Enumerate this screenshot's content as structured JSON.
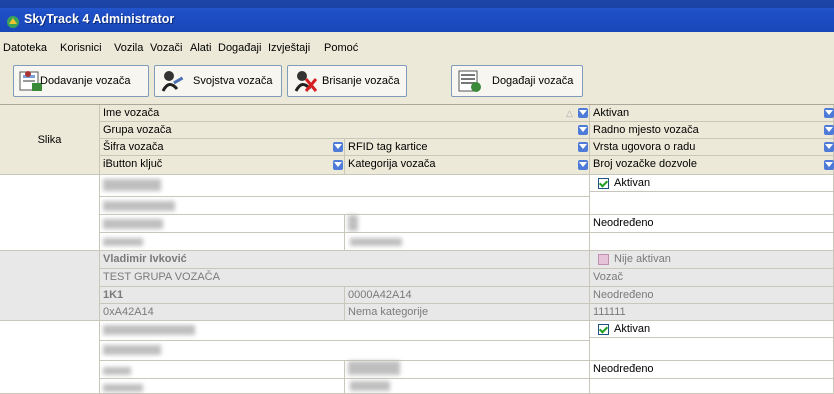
{
  "window": {
    "title": "SkyTrack 4 Administrator"
  },
  "menu": [
    "Datoteka",
    "Korisnici",
    "Vozila",
    "Vozači",
    "Alati",
    "Događaji",
    "Izvještaji",
    "Pomoć"
  ],
  "toolbar": {
    "add_driver": "Dodavanje vozača",
    "driver_props": "Svojstva vozača",
    "delete_driver": "Brisanje vozača",
    "driver_events": "Događaji vozača"
  },
  "grid": {
    "slika": "Slika",
    "col_name": "Ime vozača",
    "col_group": "Grupa vozača",
    "col_code": "Šifra vozača",
    "col_rfid": "RFID tag kartice",
    "col_ibutton": "iButton ključ",
    "col_category": "Kategorija vozača",
    "col_active": "Aktivan",
    "col_position": "Radno mjesto vozača",
    "col_contract": "Vrsta ugovora o radu",
    "col_license": "Broj vozačke dozvole"
  },
  "rows": [
    {
      "active": "Aktivan",
      "contract": "Neodređeno"
    },
    {
      "name": "Vladimir Ivković",
      "active": "Nije aktivan",
      "group": "TEST GRUPA VOZAČA",
      "position": "Vozač",
      "code": "1K1",
      "rfid": "0000A42A14",
      "contract": "Neodređeno",
      "ibutton": "0xA42A14",
      "category": "Nema kategorije",
      "license": "111111"
    },
    {
      "active": "Aktivan",
      "contract": "Neodređeno"
    }
  ],
  "colors": {
    "title_bar": "#1e4fc6",
    "chrome": "#ece9d8",
    "check": "#21a121"
  }
}
